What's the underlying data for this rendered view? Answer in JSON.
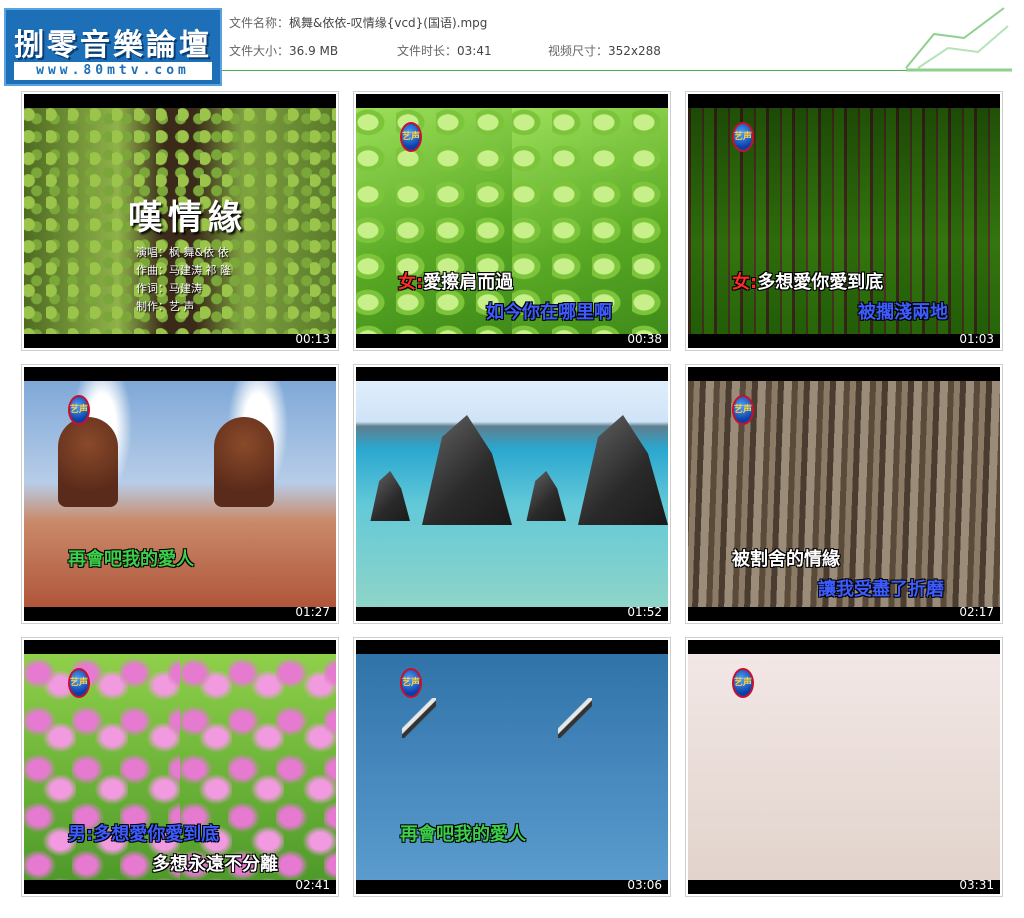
{
  "header": {
    "logo": {
      "title": "捌零音樂論壇",
      "url": "www.80mtv.com"
    },
    "file_name_label": "文件名称：",
    "file_name": "枫舞&依依-叹情缘{vcd}(国语).mpg",
    "file_size_label": "文件大小：",
    "file_size": "36.9 MB",
    "duration_label": "文件时长：",
    "duration": "03:41",
    "dimensions_label": "视频尺寸：",
    "dimensions": "352x288"
  },
  "thumbnails": [
    {
      "time": "00:13",
      "title": "嘆情緣",
      "credits": [
        "演唱：枫 舞&依 依",
        "作曲：马建涛 祁 隆",
        "作词：马建涛",
        "制作：艺 声"
      ]
    },
    {
      "time": "00:38",
      "badge": "艺声",
      "lyric1_tag": "女:",
      "lyric1": "愛擦肩而過",
      "lyric2": "如今你在哪里啊"
    },
    {
      "time": "01:03",
      "badge": "艺声",
      "lyric1_tag": "女:",
      "lyric1": "多想愛你愛到底",
      "lyric2": "被擱淺兩地"
    },
    {
      "time": "01:27",
      "badge": "艺声",
      "lyric1": "再會吧我的愛人"
    },
    {
      "time": "01:52"
    },
    {
      "time": "02:17",
      "badge": "艺声",
      "lyric1": "被割舍的情緣",
      "lyric2": "讓我受盡了折磨"
    },
    {
      "time": "02:41",
      "badge": "艺声",
      "lyric1_tag": "男:",
      "lyric1": "多想愛你愛到底",
      "lyric2": "多想永遠不分離"
    },
    {
      "time": "03:06",
      "badge": "艺声",
      "lyric1": "再會吧我的愛人"
    },
    {
      "time": "03:31",
      "badge": "艺声"
    }
  ],
  "colors": {
    "header_line": "#4caf50",
    "logo_bg": "#1d6fb8",
    "lyric_blue": "#3d5cff",
    "lyric_green": "#3cd04a",
    "lyric_red": "#ff2b2b"
  }
}
